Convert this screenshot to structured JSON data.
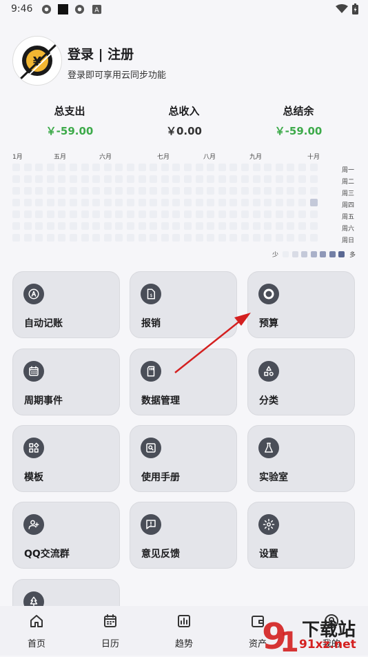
{
  "status": {
    "time": "9:46"
  },
  "profile": {
    "title": "登录 | 注册",
    "subtitle": "登录即可享用云同步功能"
  },
  "stats": [
    {
      "label": "总支出",
      "value": "￥-59.00",
      "color": "#3daa4a"
    },
    {
      "label": "总收入",
      "value": "￥0.00",
      "color": "#333333"
    },
    {
      "label": "总结余",
      "value": "￥-59.00",
      "color": "#3daa4a"
    }
  ],
  "heatmap": {
    "months": [
      "1月",
      "五月",
      "六月",
      "七月",
      "八月",
      "九月",
      "十月"
    ],
    "days": [
      "周一",
      "周二",
      "周三",
      "周四",
      "周五",
      "周六",
      "周日"
    ],
    "legend_less": "少",
    "legend_more": "多",
    "legend_colors": [
      "#eceef3",
      "#d9dce6",
      "#c4c9d9",
      "#aab1c9",
      "#8f98b8",
      "#7480a6",
      "#5a6893"
    ]
  },
  "features": [
    {
      "label": "自动记账",
      "icon": "auto-letter-a-icon"
    },
    {
      "label": "报销",
      "icon": "reimburse-document-icon"
    },
    {
      "label": "预算",
      "icon": "budget-ring-icon"
    },
    {
      "label": "周期事件",
      "icon": "calendar-grid-icon"
    },
    {
      "label": "数据管理",
      "icon": "sd-card-icon"
    },
    {
      "label": "分类",
      "icon": "shapes-icon"
    },
    {
      "label": "模板",
      "icon": "widgets-icon"
    },
    {
      "label": "使用手册",
      "icon": "manual-search-icon"
    },
    {
      "label": "实验室",
      "icon": "flask-icon"
    },
    {
      "label": "QQ交流群",
      "icon": "add-user-icon"
    },
    {
      "label": "意见反馈",
      "icon": "feedback-bubble-icon"
    },
    {
      "label": "设置",
      "icon": "gear-icon"
    },
    {
      "label": "",
      "icon": "tree-icon"
    }
  ],
  "nav": [
    {
      "label": "首页",
      "icon": "home-icon"
    },
    {
      "label": "日历",
      "icon": "calendar-icon"
    },
    {
      "label": "趋势",
      "icon": "chart-icon"
    },
    {
      "label": "资产",
      "icon": "wallet-icon"
    },
    {
      "label": "我的",
      "icon": "profile-icon"
    }
  ],
  "watermark": {
    "big": "下载站",
    "small": "91xz.net"
  },
  "colors": {
    "accent": "#3daa4a",
    "arrow": "#d42020",
    "icon_bg": "#4a4e58"
  }
}
